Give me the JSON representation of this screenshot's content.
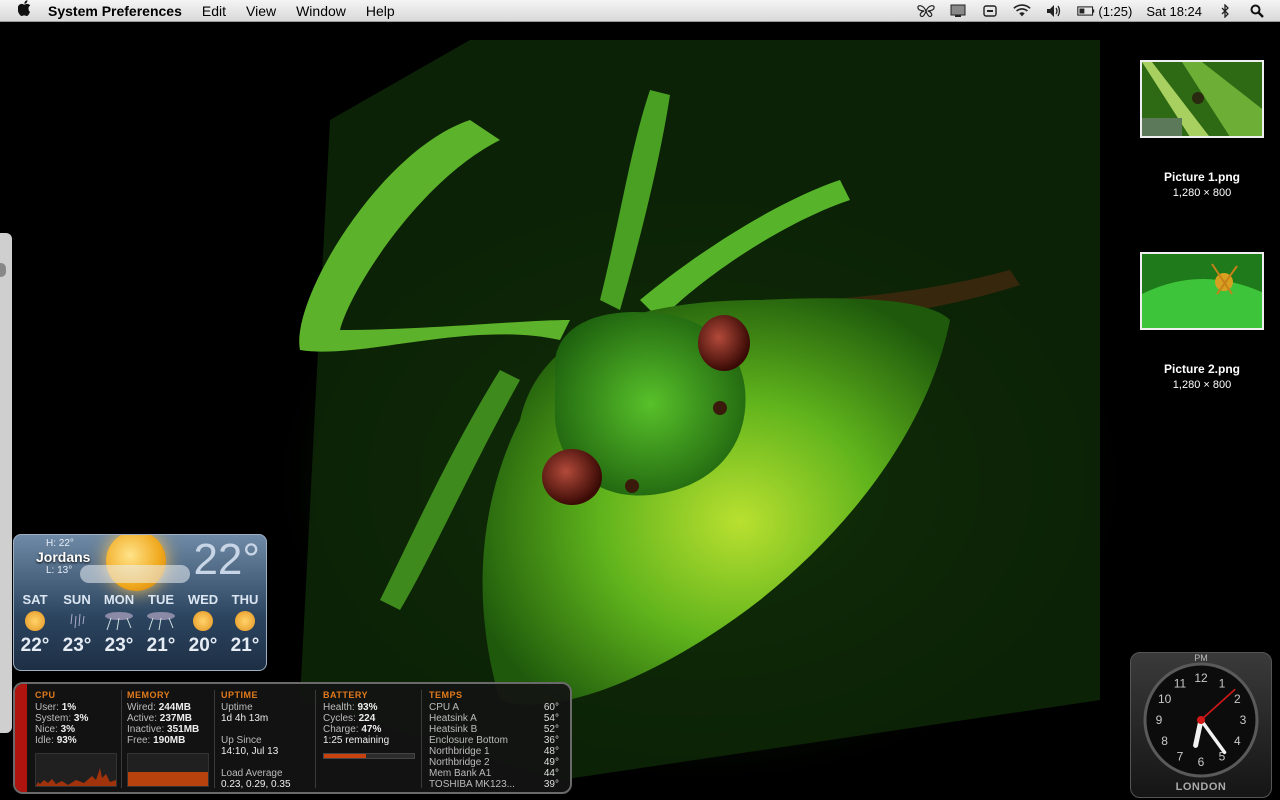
{
  "menubar": {
    "app_name": "System Preferences",
    "items": [
      "Edit",
      "View",
      "Window",
      "Help"
    ],
    "battery_time": "(1:25)",
    "clock": "Sat 18:24",
    "icons": [
      "butterfly-icon",
      "display-icon",
      "keyboard-icon",
      "wifi-icon",
      "volume-icon",
      "battery-icon",
      "bluetooth-icon",
      "spotlight-icon"
    ]
  },
  "desktop_icons": [
    {
      "name": "Picture 1.png",
      "dimensions": "1,280 × 800"
    },
    {
      "name": "Picture 2.png",
      "dimensions": "1,280 × 800"
    }
  ],
  "weather": {
    "high": "H: 22°",
    "location": "Jordans",
    "low": "L: 13°",
    "current_temp": "22°",
    "forecast": [
      {
        "day": "SAT",
        "temp": "22°",
        "icon": "sun-icon"
      },
      {
        "day": "SUN",
        "temp": "23°",
        "icon": "rain-icon"
      },
      {
        "day": "MON",
        "temp": "23°",
        "icon": "thunderstorm-icon"
      },
      {
        "day": "TUE",
        "temp": "21°",
        "icon": "thunderstorm-icon"
      },
      {
        "day": "WED",
        "temp": "20°",
        "icon": "sun-icon"
      },
      {
        "day": "THU",
        "temp": "21°",
        "icon": "sun-icon"
      }
    ]
  },
  "istat": {
    "cpu": {
      "header": "CPU",
      "rows": [
        [
          "User:",
          "1%"
        ],
        [
          "System:",
          "3%"
        ],
        [
          "Nice:",
          "3%"
        ],
        [
          "Idle:",
          "93%"
        ]
      ]
    },
    "memory": {
      "header": "MEMORY",
      "rows": [
        [
          "Wired:",
          "244MB"
        ],
        [
          "Active:",
          "237MB"
        ],
        [
          "Inactive:",
          "351MB"
        ],
        [
          "Free:",
          "190MB"
        ]
      ]
    },
    "uptime": {
      "header": "UPTIME",
      "uptime_label": "Uptime",
      "uptime_value": "1d 4h 13m",
      "since_label": "Up Since",
      "since_value": "14:10, Jul 13",
      "load_label": "Load Average",
      "load_value": "0.23, 0.29, 0.35"
    },
    "battery": {
      "header": "BATTERY",
      "rows": [
        [
          "Health:",
          "93%"
        ],
        [
          "Cycles:",
          "224"
        ],
        [
          "Charge:",
          "47%"
        ]
      ],
      "remaining": "1:25 remaining",
      "charge_fraction": 0.47
    },
    "temps": {
      "header": "TEMPS",
      "rows": [
        [
          "CPU A",
          "60°"
        ],
        [
          "Heatsink A",
          "54°"
        ],
        [
          "Heatsink B",
          "52°"
        ],
        [
          "Enclosure Bottom",
          "36°"
        ],
        [
          "Northbridge 1",
          "48°"
        ],
        [
          "Northbridge 2",
          "49°"
        ],
        [
          "Mem Bank A1",
          "44°"
        ],
        [
          "TOSHIBA MK123...",
          "39°"
        ]
      ]
    }
  },
  "clock": {
    "ampm": "PM",
    "city": "LONDON",
    "numbers": [
      "12",
      "1",
      "2",
      "3",
      "4",
      "5",
      "6",
      "7",
      "8",
      "9",
      "10",
      "11"
    ],
    "hour": 6,
    "minute": 24,
    "second": 8
  }
}
